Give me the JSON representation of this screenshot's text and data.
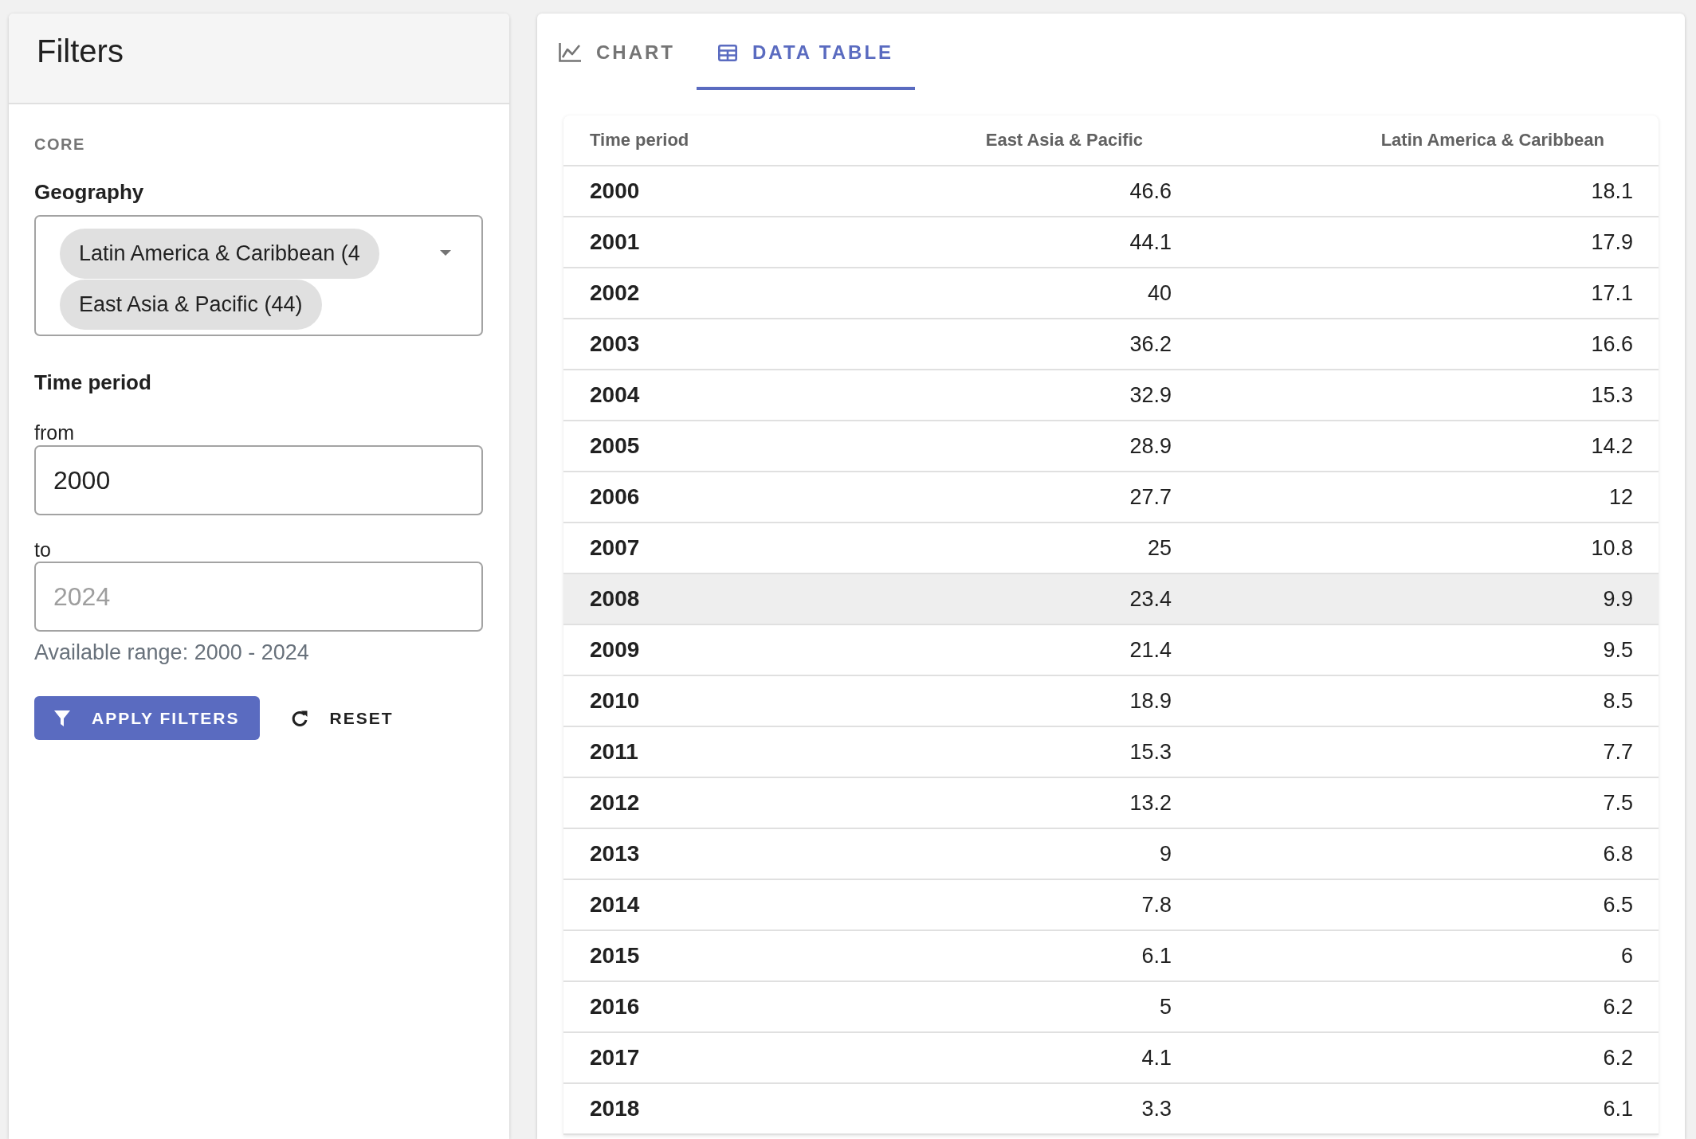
{
  "filters_panel": {
    "title": "Filters",
    "section_label": "CORE",
    "geography": {
      "label": "Geography",
      "chips": [
        "Latin America & Caribbean (4",
        "East Asia & Pacific (44)"
      ]
    },
    "time_period": {
      "label": "Time period",
      "from": {
        "label": "from",
        "value": "2000"
      },
      "to": {
        "label": "to",
        "placeholder": "2024"
      },
      "helper_text": "Available range: 2000 - 2024"
    },
    "buttons": [
      {
        "label": "APPLY FILTERS",
        "kind": "primary"
      },
      {
        "label": "RESET",
        "kind": "text"
      }
    ]
  },
  "view_panel": {
    "tabs": [
      {
        "label": "CHART",
        "selected": false
      },
      {
        "label": "DATA TABLE",
        "selected": true
      }
    ],
    "table": {
      "columns": [
        "Time period",
        "East Asia & Pacific",
        "Latin America & Caribbean"
      ],
      "rows": [
        {
          "cells": [
            "2000",
            "46.6",
            "18.1"
          ],
          "highlighted": false
        },
        {
          "cells": [
            "2001",
            "44.1",
            "17.9"
          ],
          "highlighted": false
        },
        {
          "cells": [
            "2002",
            "40",
            "17.1"
          ],
          "highlighted": false
        },
        {
          "cells": [
            "2003",
            "36.2",
            "16.6"
          ],
          "highlighted": false
        },
        {
          "cells": [
            "2004",
            "32.9",
            "15.3"
          ],
          "highlighted": false
        },
        {
          "cells": [
            "2005",
            "28.9",
            "14.2"
          ],
          "highlighted": false
        },
        {
          "cells": [
            "2006",
            "27.7",
            "12"
          ],
          "highlighted": false
        },
        {
          "cells": [
            "2007",
            "25",
            "10.8"
          ],
          "highlighted": false
        },
        {
          "cells": [
            "2008",
            "23.4",
            "9.9"
          ],
          "highlighted": true
        },
        {
          "cells": [
            "2009",
            "21.4",
            "9.5"
          ],
          "highlighted": false
        },
        {
          "cells": [
            "2010",
            "18.9",
            "8.5"
          ],
          "highlighted": false
        },
        {
          "cells": [
            "2011",
            "15.3",
            "7.7"
          ],
          "highlighted": false
        },
        {
          "cells": [
            "2012",
            "13.2",
            "7.5"
          ],
          "highlighted": false
        },
        {
          "cells": [
            "2013",
            "9",
            "6.8"
          ],
          "highlighted": false
        },
        {
          "cells": [
            "2014",
            "7.8",
            "6.5"
          ],
          "highlighted": false
        },
        {
          "cells": [
            "2015",
            "6.1",
            "6"
          ],
          "highlighted": false
        },
        {
          "cells": [
            "2016",
            "5",
            "6.2"
          ],
          "highlighted": false
        },
        {
          "cells": [
            "2017",
            "4.1",
            "6.2"
          ],
          "highlighted": false
        },
        {
          "cells": [
            "2018",
            "3.3",
            "6.1"
          ],
          "highlighted": false
        }
      ]
    }
  }
}
